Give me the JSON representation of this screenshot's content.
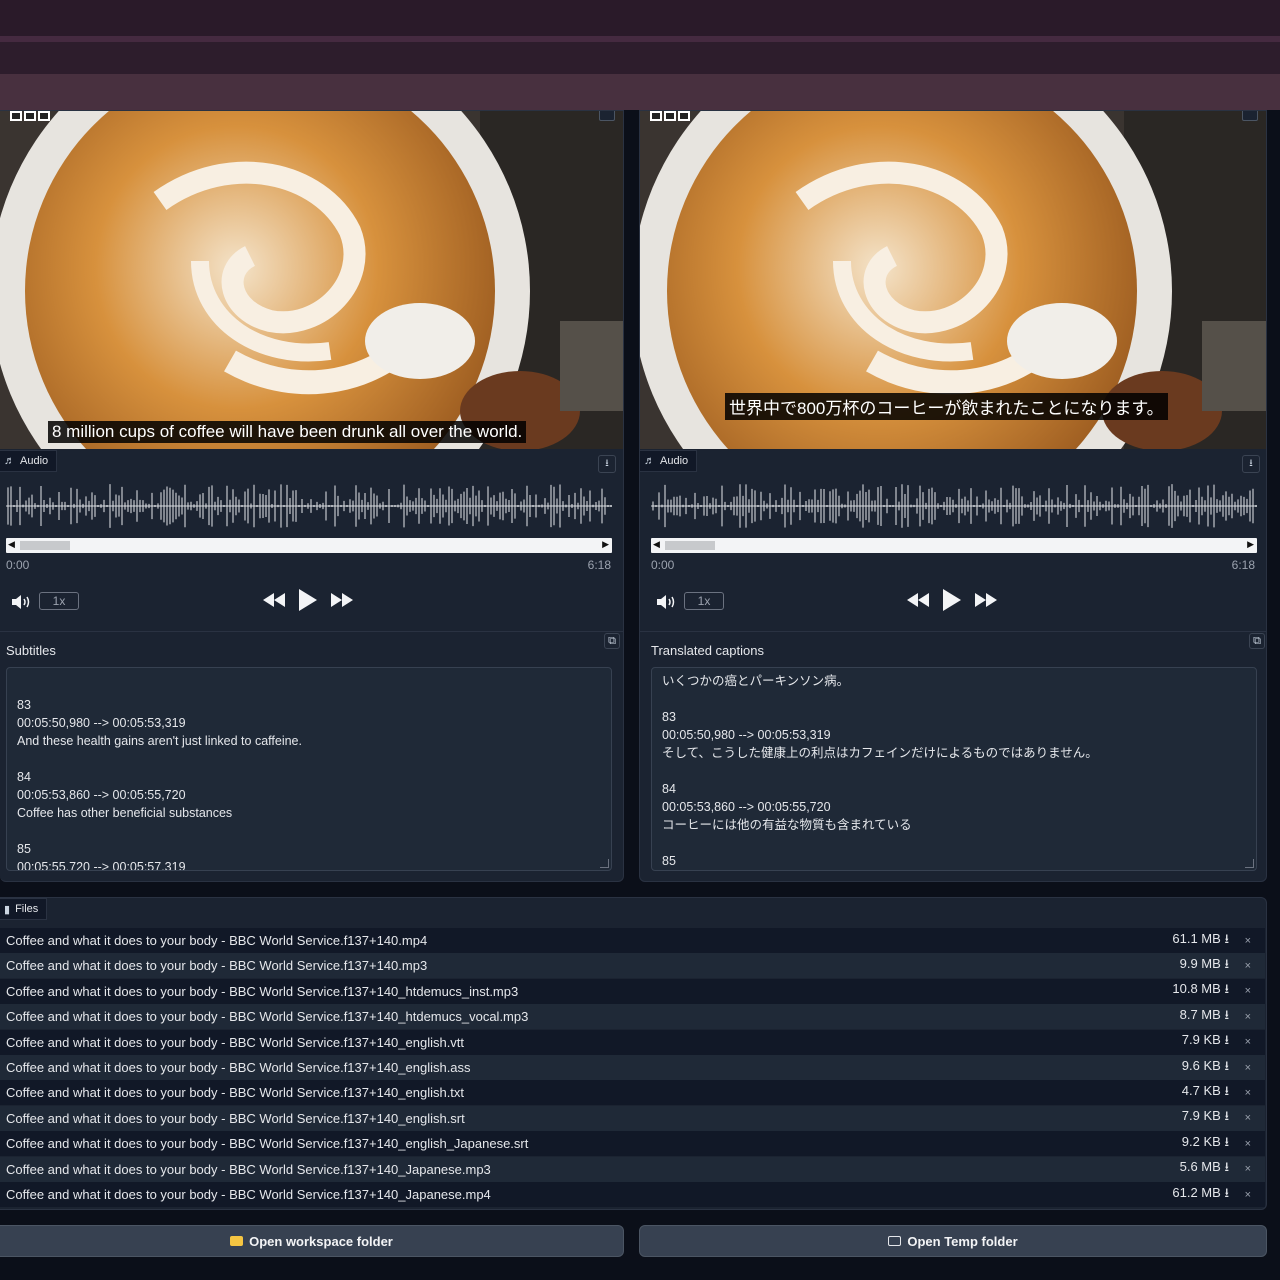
{
  "colors": {
    "page_bg": "#0b0f19",
    "panel_bg": "#1b2331",
    "folder_yellow": "#f5c542"
  },
  "left": {
    "subtitle": "8 million cups of coffee will have been drunk all over the world.",
    "audio_label": "Audio",
    "time_start": "0:00",
    "time_end": "6:18",
    "speed": "1x",
    "section_title": "Subtitles",
    "text_lines": [
      "",
      "83",
      "00:05:50,980 --> 00:05:53,319",
      "And these health gains aren't just linked to caffeine.",
      "",
      "84",
      "00:05:53,860 --> 00:05:55,720",
      "Coffee has other beneficial substances",
      "",
      "85",
      "00:05:55,720 --> 00:05:57,319"
    ]
  },
  "right": {
    "subtitle": "世界中で800万杯のコーヒーが飲まれたことになります。",
    "audio_label": "Audio",
    "time_start": "0:00",
    "time_end": "6:18",
    "speed": "1x",
    "section_title": "Translated captions",
    "text_lines": [
      "いくつかの癌とパーキンソン病。",
      "",
      "83",
      "00:05:50,980 --> 00:05:53,319",
      "そして、こうした健康上の利点はカフェインだけによるものではありません。",
      "",
      "84",
      "00:05:53,860 --> 00:05:55,720",
      "コーヒーには他の有益な物質も含まれている",
      "",
      "85"
    ]
  },
  "files": {
    "label": "Files",
    "items": [
      {
        "name": "Coffee and what it does to your body - BBC World Service.f137+140.mp4",
        "size": "61.1 MB"
      },
      {
        "name": "Coffee and what it does to your body - BBC World Service.f137+140.mp3",
        "size": "9.9 MB"
      },
      {
        "name": "Coffee and what it does to your body - BBC World Service.f137+140_htdemucs_inst.mp3",
        "size": "10.8 MB"
      },
      {
        "name": "Coffee and what it does to your body - BBC World Service.f137+140_htdemucs_vocal.mp3",
        "size": "8.7 MB"
      },
      {
        "name": "Coffee and what it does to your body - BBC World Service.f137+140_english.vtt",
        "size": "7.9 KB"
      },
      {
        "name": "Coffee and what it does to your body - BBC World Service.f137+140_english.ass",
        "size": "9.6 KB"
      },
      {
        "name": "Coffee and what it does to your body - BBC World Service.f137+140_english.txt",
        "size": "4.7 KB"
      },
      {
        "name": "Coffee and what it does to your body - BBC World Service.f137+140_english.srt",
        "size": "7.9 KB"
      },
      {
        "name": "Coffee and what it does to your body - BBC World Service.f137+140_english_Japanese.srt",
        "size": "9.2 KB"
      },
      {
        "name": "Coffee and what it does to your body - BBC World Service.f137+140_Japanese.mp3",
        "size": "5.6 MB"
      },
      {
        "name": "Coffee and what it does to your body - BBC World Service.f137+140_Japanese.mp4",
        "size": "61.2 MB"
      }
    ],
    "download_glyph": "⭳",
    "remove_glyph": "×"
  },
  "buttons": {
    "workspace": "Open workspace folder",
    "temp": "Open Temp folder"
  }
}
